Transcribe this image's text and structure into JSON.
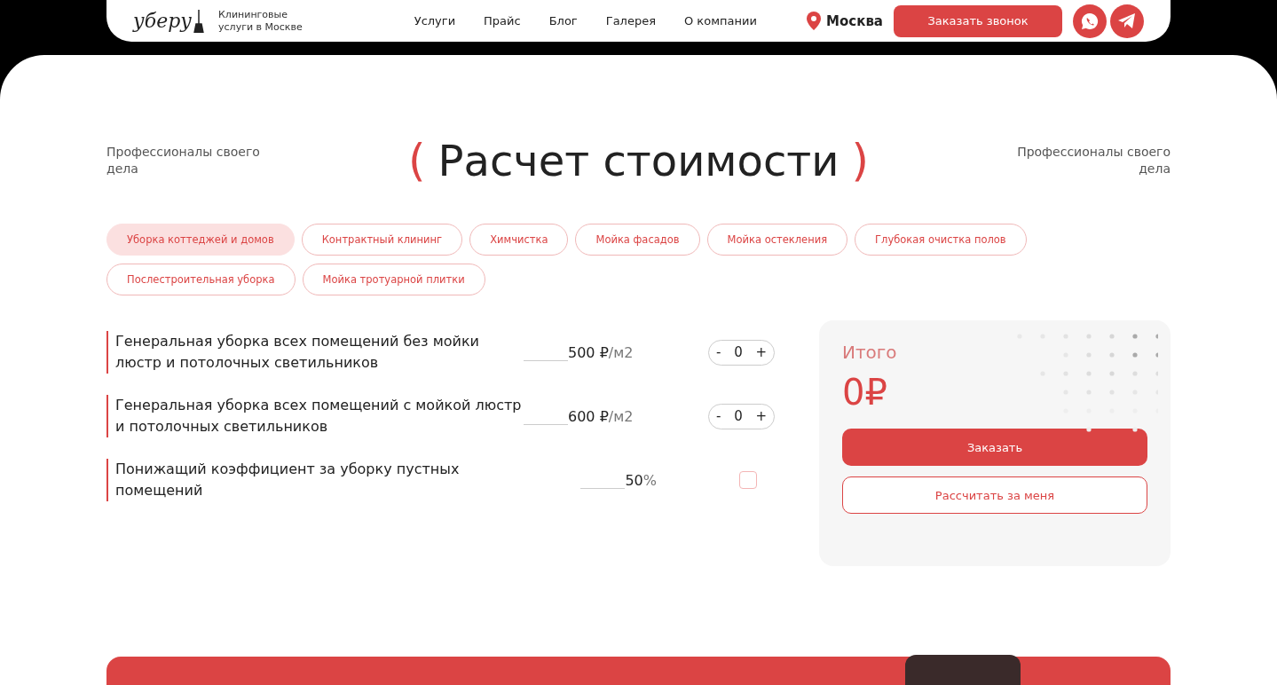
{
  "header": {
    "logo": "уберу",
    "tagline": "Клининговые\nуслуги в Москве",
    "nav": [
      "Услуги",
      "Прайс",
      "Блог",
      "Галерея",
      "О компании"
    ],
    "city": "Москва",
    "call_button": "Заказать звонок"
  },
  "hero": {
    "side_left": "Профессионалы своего\nдела",
    "title_open": "(",
    "title": "Расчет стоимости",
    "title_close": ")",
    "side_right": "Профессионалы своего\nдела"
  },
  "tabs": [
    {
      "label": "Уборка коттеджей и домов",
      "selected": true
    },
    {
      "label": "Контрактный клининг",
      "selected": false
    },
    {
      "label": "Химчистка",
      "selected": false
    },
    {
      "label": "Мойка фасадов",
      "selected": false
    },
    {
      "label": "Мойка остекления",
      "selected": false
    },
    {
      "label": "Глубокая очистка полов",
      "selected": false
    },
    {
      "label": "Послестроительная уборка",
      "selected": false
    },
    {
      "label": "Мойка тротуарной плитки",
      "selected": false
    }
  ],
  "services": [
    {
      "kind": "counter",
      "name": "Генеральная уборка всех помещений без мойки люстр и потолочных светильников",
      "price": "500 ₽",
      "unit": "/м2",
      "minus": "-",
      "count": "0",
      "plus": "+"
    },
    {
      "kind": "counter",
      "name": "Генеральная уборка всех помещений с мойкой люстр и потолочных светильников",
      "price": "600 ₽",
      "unit": "/м2",
      "minus": "-",
      "count": "0",
      "plus": "+"
    },
    {
      "kind": "checkbox",
      "name": "Понижащий коэффициент за уборку пустных помещений",
      "price": "50",
      "unit": "%",
      "checked": false
    }
  ],
  "summary": {
    "label": "Итого",
    "total": "0₽",
    "order_button": "Заказать",
    "calc_button": "Рассчитать за меня"
  }
}
